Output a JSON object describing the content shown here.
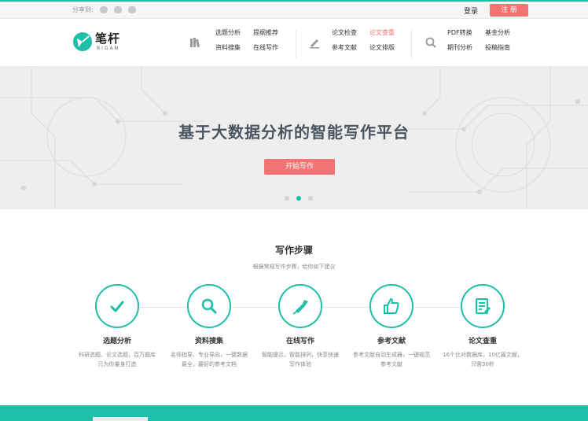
{
  "topbar": {
    "share_label": "分享到:",
    "login": "登录",
    "register": "注 册"
  },
  "logo": {
    "cn": "笔杆",
    "en": "BIGAN"
  },
  "nav": {
    "group1": [
      "选题分析",
      "提纲推荐",
      "资料搜集",
      "在线写作"
    ],
    "group2": [
      "论文检查",
      "论文查重",
      "参考文献",
      "论文排版"
    ],
    "group3": [
      "PDF转换",
      "基金分析",
      "期刊分析",
      "投稿指南"
    ]
  },
  "hero": {
    "title": "基于大数据分析的智能写作平台",
    "button": "开始写作"
  },
  "steps": {
    "title": "写作步骤",
    "subtitle": "根据常规写作步骤，给你如下建议",
    "items": [
      {
        "title": "选题分析",
        "desc": "科研选题、论文选题，百万题库只为你量身打造",
        "icon": "check-icon"
      },
      {
        "title": "资料搜集",
        "desc": "名师指导、专业导向，一健数据最全，最好的参考文档",
        "icon": "search-icon"
      },
      {
        "title": "在线写作",
        "desc": "智能提示，智能排列，快享快速写作体验",
        "icon": "pen-icon"
      },
      {
        "title": "参考文献",
        "desc": "参考文献自动生成器，一键规范参考文献",
        "icon": "thumbs-up-icon"
      },
      {
        "title": "论文查重",
        "desc": "16个比对数据库，10亿篇文献，只需30秒",
        "icon": "document-icon"
      }
    ]
  },
  "colors": {
    "accent": "#1dbfa8",
    "button": "#f37373"
  }
}
